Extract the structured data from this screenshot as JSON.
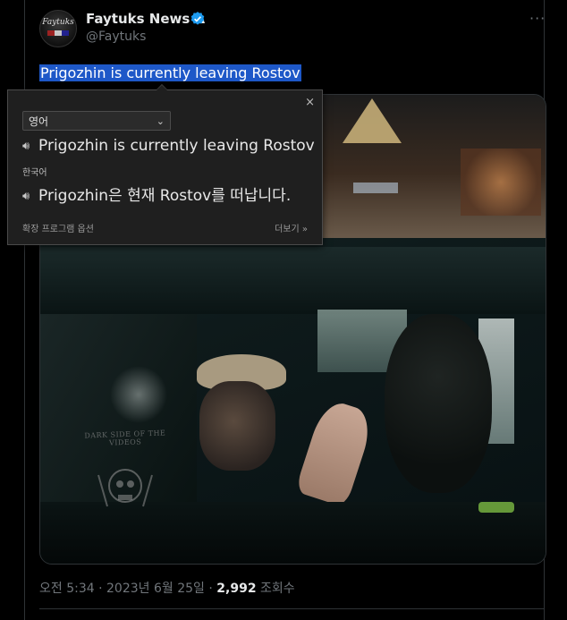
{
  "author": {
    "name": "Faytuks News Δ",
    "handle": "@Faytuks",
    "avatar_text": "Faytuks"
  },
  "more_label": "···",
  "tweet": {
    "text": "Prigozhin is currently leaving Rostov"
  },
  "media": {
    "watermark": "DARK SIDE OF THE VIDEOS"
  },
  "meta": {
    "time": "오전 5:34",
    "sep1": " · ",
    "date": "2023년 6월 25일",
    "sep2": " · ",
    "views_count": "2,992",
    "views_label": " 조회수"
  },
  "translate_popup": {
    "close": "×",
    "source_lang": "영어",
    "source_text": "Prigozhin is currently leaving Rostov",
    "target_lang": "한국어",
    "translated_text": "Prigozhin은 현재 Rostov를 떠납니다.",
    "options_label": "확장 프로그램 옵션",
    "more_label": "더보기 »"
  },
  "colors": {
    "accent": "#1d9bf0",
    "selection": "#1e58c8",
    "muted": "#71767b"
  }
}
